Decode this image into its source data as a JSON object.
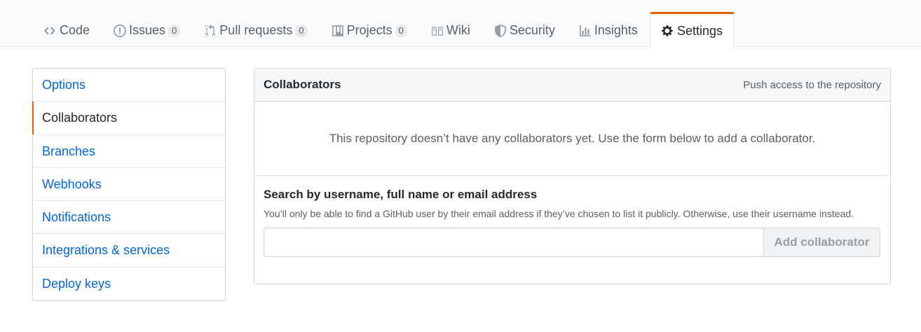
{
  "reponav": {
    "tabs": [
      {
        "label": "Code",
        "icon": "code-icon",
        "counter": null,
        "selected": false
      },
      {
        "label": "Issues",
        "icon": "issue-opened-icon",
        "counter": "0",
        "selected": false
      },
      {
        "label": "Pull requests",
        "icon": "git-pull-request-icon",
        "counter": "0",
        "selected": false
      },
      {
        "label": "Projects",
        "icon": "project-icon",
        "counter": "0",
        "selected": false
      },
      {
        "label": "Wiki",
        "icon": "book-icon",
        "counter": null,
        "selected": false
      },
      {
        "label": "Security",
        "icon": "shield-icon",
        "counter": null,
        "selected": false
      },
      {
        "label": "Insights",
        "icon": "graph-icon",
        "counter": null,
        "selected": false
      },
      {
        "label": "Settings",
        "icon": "gear-icon",
        "counter": null,
        "selected": true
      }
    ]
  },
  "menu": {
    "items": [
      {
        "label": "Options",
        "selected": false
      },
      {
        "label": "Collaborators",
        "selected": true
      },
      {
        "label": "Branches",
        "selected": false
      },
      {
        "label": "Webhooks",
        "selected": false
      },
      {
        "label": "Notifications",
        "selected": false
      },
      {
        "label": "Integrations & services",
        "selected": false
      },
      {
        "label": "Deploy keys",
        "selected": false
      }
    ]
  },
  "collaborators": {
    "title": "Collaborators",
    "note": "Push access to the repository",
    "empty_message": "This repository doesn’t have any collaborators yet. Use the form below to add a collaborator.",
    "search_label": "Search by username, full name or email address",
    "search_note": "You’ll only be able to find a GitHub user by their email address if they’ve chosen to list it publicly. Otherwise, use their username instead.",
    "search_value": "",
    "add_button_label": "Add collaborator"
  },
  "colors": {
    "accent": "#e36209",
    "link": "#0366d6",
    "text": "#24292e",
    "muted": "#586069"
  }
}
